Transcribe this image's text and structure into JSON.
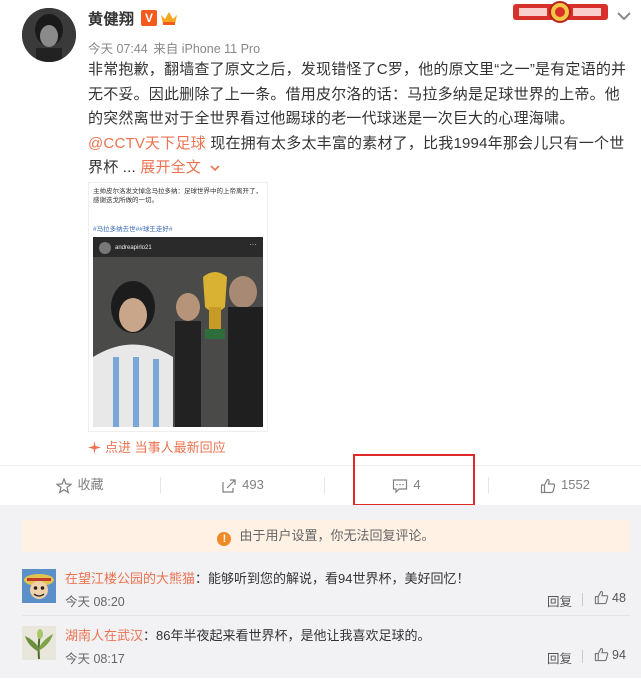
{
  "post": {
    "username": "黄健翔",
    "v_badge": "V",
    "time": "今天 07:44",
    "source": "来自 iPhone 11 Pro",
    "body_line1": "非常抱歉，翻墙查了原文之后，发现错怪了C罗，他的原文里“之一”是有定语的并",
    "body_line2": "无不妥。因此删除了上一条。借用皮尔洛的话：马拉多纳是足球世界的上帝。他",
    "body_line3": "的突然离世对于全世界看过他踢球的老一代球迷是一次巨大的心理海啸。",
    "mention": "@CCTV天下足球",
    "body_line4_rest": " 现在拥有太多太丰富的素材了，比我1994年那会儿只有一个世",
    "body_line5": "界杯 ...",
    "expand_label": "展开全文",
    "repost_text": "主帅皮尔洛发文悼念马拉多纳：足球世界中的上帝离开了，感谢迭戈所做的一切。",
    "repost_tags": "#马拉多纳去世##球王走好#",
    "repost_account": "andreapirlo21",
    "respond_label": "点进 当事人最新回应"
  },
  "actions": {
    "favorite_label": "收藏",
    "share_count": "493",
    "comment_count": "4",
    "like_count": "1552"
  },
  "comments_section": {
    "notice": "由于用户设置，你无法回复评论。",
    "reply_label": "回复",
    "items": [
      {
        "name": "在望江楼公园的大熊猫",
        "text": "：能够听到您的解说，看94世界杯，美好回忆！",
        "time": "今天 08:20",
        "likes": "48"
      },
      {
        "name": "湖南人在武汉",
        "text": "：86年半夜起来看世界杯，是他让我喜欢足球的。",
        "time": "今天 08:17",
        "likes": "94"
      }
    ]
  },
  "colors": {
    "accent": "#eb7350",
    "highlight": "#e02a2a",
    "notice_bg": "#fff1e3"
  }
}
